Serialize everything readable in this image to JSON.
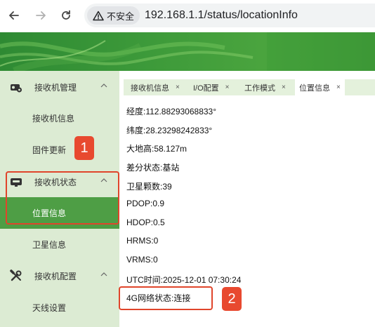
{
  "browser": {
    "security_label": "不安全",
    "url": "192.168.1.1/status/locationInfo"
  },
  "sidebar": {
    "groups": [
      {
        "label": "接收机管理",
        "icon": "receiver-icon",
        "items": [
          {
            "label": "接收机信息"
          },
          {
            "label": "固件更新"
          }
        ]
      },
      {
        "label": "接收机状态",
        "icon": "status-icon",
        "items": [
          {
            "label": "位置信息",
            "active": true
          },
          {
            "label": "卫星信息"
          }
        ]
      },
      {
        "label": "接收机配置",
        "icon": "tools-icon",
        "items": [
          {
            "label": "天线设置"
          }
        ]
      }
    ]
  },
  "tabs": [
    {
      "label": "接收机信息",
      "close": "×"
    },
    {
      "label": "I/O配置",
      "close": "×"
    },
    {
      "label": "工作模式",
      "close": "×"
    },
    {
      "label": "位置信息",
      "close": "×",
      "active": true
    }
  ],
  "location_info": [
    "经度:112.88293068833°",
    "纬度:28.23298242833°",
    "大地高:58.127m",
    "差分状态:基站",
    "卫星颗数:39",
    "PDOP:0.9",
    "HDOP:0.5",
    "HRMS:0",
    "VRMS:0",
    "UTC时间:2025-12-01 07:30:24",
    "4G网络状态:连接"
  ],
  "annotations": {
    "badge_1": "1",
    "badge_2": "2"
  },
  "colors": {
    "accent_green": "#4e9e45",
    "sidebar_bg": "#dcebd3",
    "annotation_red": "#e0452b"
  }
}
